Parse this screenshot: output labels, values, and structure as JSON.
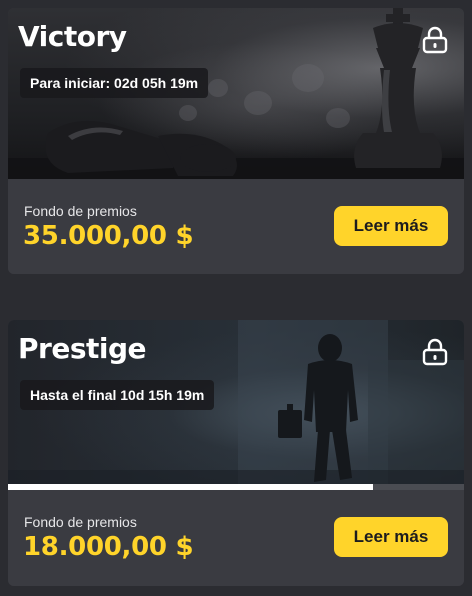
{
  "tournaments": [
    {
      "title": "Victory",
      "timer": "Para iniciar: 02d 05h 19m",
      "prize_label": "Fondo de premios",
      "prize_value": "35.000,00 $",
      "button_label": "Leer más",
      "locked": true,
      "image": "chess-pieces"
    },
    {
      "title": "Prestige",
      "timer": "Hasta el final 10d 15h 19m",
      "prize_label": "Fondo de premios",
      "prize_value": "18.000,00 $",
      "button_label": "Leer más",
      "locked": true,
      "image": "businessman-walking",
      "progress_fraction": 0.8
    }
  ],
  "colors": {
    "accent": "#ffd42a",
    "card": "#3a3b41",
    "background": "#2b2c31"
  }
}
